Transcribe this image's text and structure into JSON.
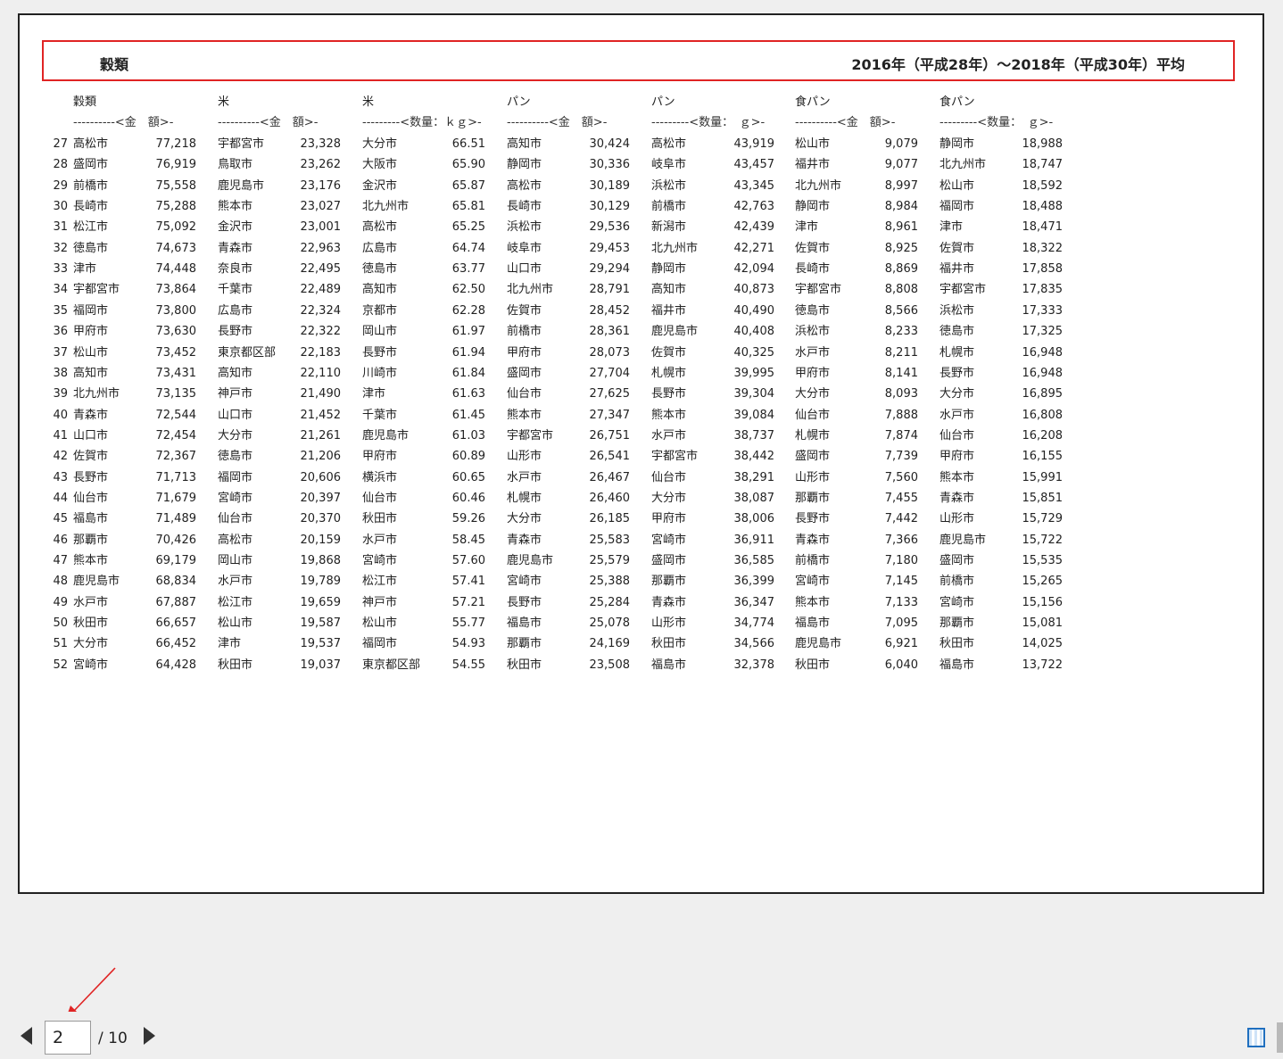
{
  "document": {
    "title_left": "穀類",
    "title_right": "2016年（平成28年）～2018年（平成30年）平均",
    "columns": [
      {
        "header": "穀類",
        "unit": "----------<金　額>-"
      },
      {
        "header": "米",
        "unit": "----------<金　額>-"
      },
      {
        "header": "米",
        "unit": "---------<数量：ｋｇ>-"
      },
      {
        "header": "パン",
        "unit": "----------<金　額>-"
      },
      {
        "header": "パン",
        "unit": "---------<数量：　ｇ>-"
      },
      {
        "header": "食パン",
        "unit": "----------<金　額>-"
      },
      {
        "header": "食パン",
        "unit": "---------<数量：　ｇ>-"
      }
    ],
    "rows": [
      {
        "rank": "27",
        "c": [
          [
            "高松市",
            "77,218"
          ],
          [
            "宇都宮市",
            "23,328"
          ],
          [
            "大分市",
            "66.51"
          ],
          [
            "高知市",
            "30,424"
          ],
          [
            "高松市",
            "43,919"
          ],
          [
            "松山市",
            "9,079"
          ],
          [
            "静岡市",
            "18,988"
          ]
        ]
      },
      {
        "rank": "28",
        "c": [
          [
            "盛岡市",
            "76,919"
          ],
          [
            "鳥取市",
            "23,262"
          ],
          [
            "大阪市",
            "65.90"
          ],
          [
            "静岡市",
            "30,336"
          ],
          [
            "岐阜市",
            "43,457"
          ],
          [
            "福井市",
            "9,077"
          ],
          [
            "北九州市",
            "18,747"
          ]
        ]
      },
      {
        "rank": "29",
        "c": [
          [
            "前橋市",
            "75,558"
          ],
          [
            "鹿児島市",
            "23,176"
          ],
          [
            "金沢市",
            "65.87"
          ],
          [
            "高松市",
            "30,189"
          ],
          [
            "浜松市",
            "43,345"
          ],
          [
            "北九州市",
            "8,997"
          ],
          [
            "松山市",
            "18,592"
          ]
        ]
      },
      {
        "rank": "30",
        "c": [
          [
            "長崎市",
            "75,288"
          ],
          [
            "熊本市",
            "23,027"
          ],
          [
            "北九州市",
            "65.81"
          ],
          [
            "長崎市",
            "30,129"
          ],
          [
            "前橋市",
            "42,763"
          ],
          [
            "静岡市",
            "8,984"
          ],
          [
            "福岡市",
            "18,488"
          ]
        ]
      },
      {
        "rank": "31",
        "c": [
          [
            "松江市",
            "75,092"
          ],
          [
            "金沢市",
            "23,001"
          ],
          [
            "高松市",
            "65.25"
          ],
          [
            "浜松市",
            "29,536"
          ],
          [
            "新潟市",
            "42,439"
          ],
          [
            "津市",
            "8,961"
          ],
          [
            "津市",
            "18,471"
          ]
        ]
      },
      {
        "rank": "32",
        "c": [
          [
            "徳島市",
            "74,673"
          ],
          [
            "青森市",
            "22,963"
          ],
          [
            "広島市",
            "64.74"
          ],
          [
            "岐阜市",
            "29,453"
          ],
          [
            "北九州市",
            "42,271"
          ],
          [
            "佐賀市",
            "8,925"
          ],
          [
            "佐賀市",
            "18,322"
          ]
        ]
      },
      {
        "rank": "33",
        "c": [
          [
            "津市",
            "74,448"
          ],
          [
            "奈良市",
            "22,495"
          ],
          [
            "徳島市",
            "63.77"
          ],
          [
            "山口市",
            "29,294"
          ],
          [
            "静岡市",
            "42,094"
          ],
          [
            "長崎市",
            "8,869"
          ],
          [
            "福井市",
            "17,858"
          ]
        ]
      },
      {
        "rank": "34",
        "c": [
          [
            "宇都宮市",
            "73,864"
          ],
          [
            "千葉市",
            "22,489"
          ],
          [
            "高知市",
            "62.50"
          ],
          [
            "北九州市",
            "28,791"
          ],
          [
            "高知市",
            "40,873"
          ],
          [
            "宇都宮市",
            "8,808"
          ],
          [
            "宇都宮市",
            "17,835"
          ]
        ]
      },
      {
        "rank": "35",
        "c": [
          [
            "福岡市",
            "73,800"
          ],
          [
            "広島市",
            "22,324"
          ],
          [
            "京都市",
            "62.28"
          ],
          [
            "佐賀市",
            "28,452"
          ],
          [
            "福井市",
            "40,490"
          ],
          [
            "徳島市",
            "8,566"
          ],
          [
            "浜松市",
            "17,333"
          ]
        ]
      },
      {
        "rank": "36",
        "c": [
          [
            "甲府市",
            "73,630"
          ],
          [
            "長野市",
            "22,322"
          ],
          [
            "岡山市",
            "61.97"
          ],
          [
            "前橋市",
            "28,361"
          ],
          [
            "鹿児島市",
            "40,408"
          ],
          [
            "浜松市",
            "8,233"
          ],
          [
            "徳島市",
            "17,325"
          ]
        ]
      },
      {
        "rank": "37",
        "c": [
          [
            "松山市",
            "73,452"
          ],
          [
            "東京都区部",
            "22,183"
          ],
          [
            "長野市",
            "61.94"
          ],
          [
            "甲府市",
            "28,073"
          ],
          [
            "佐賀市",
            "40,325"
          ],
          [
            "水戸市",
            "8,211"
          ],
          [
            "札幌市",
            "16,948"
          ]
        ]
      },
      {
        "rank": "38",
        "c": [
          [
            "高知市",
            "73,431"
          ],
          [
            "高知市",
            "22,110"
          ],
          [
            "川崎市",
            "61.84"
          ],
          [
            "盛岡市",
            "27,704"
          ],
          [
            "札幌市",
            "39,995"
          ],
          [
            "甲府市",
            "8,141"
          ],
          [
            "長野市",
            "16,948"
          ]
        ]
      },
      {
        "rank": "39",
        "c": [
          [
            "北九州市",
            "73,135"
          ],
          [
            "神戸市",
            "21,490"
          ],
          [
            "津市",
            "61.63"
          ],
          [
            "仙台市",
            "27,625"
          ],
          [
            "長野市",
            "39,304"
          ],
          [
            "大分市",
            "8,093"
          ],
          [
            "大分市",
            "16,895"
          ]
        ]
      },
      {
        "rank": "40",
        "c": [
          [
            "青森市",
            "72,544"
          ],
          [
            "山口市",
            "21,452"
          ],
          [
            "千葉市",
            "61.45"
          ],
          [
            "熊本市",
            "27,347"
          ],
          [
            "熊本市",
            "39,084"
          ],
          [
            "仙台市",
            "7,888"
          ],
          [
            "水戸市",
            "16,808"
          ]
        ]
      },
      {
        "rank": "41",
        "c": [
          [
            "山口市",
            "72,454"
          ],
          [
            "大分市",
            "21,261"
          ],
          [
            "鹿児島市",
            "61.03"
          ],
          [
            "宇都宮市",
            "26,751"
          ],
          [
            "水戸市",
            "38,737"
          ],
          [
            "札幌市",
            "7,874"
          ],
          [
            "仙台市",
            "16,208"
          ]
        ]
      },
      {
        "rank": "42",
        "c": [
          [
            "佐賀市",
            "72,367"
          ],
          [
            "徳島市",
            "21,206"
          ],
          [
            "甲府市",
            "60.89"
          ],
          [
            "山形市",
            "26,541"
          ],
          [
            "宇都宮市",
            "38,442"
          ],
          [
            "盛岡市",
            "7,739"
          ],
          [
            "甲府市",
            "16,155"
          ]
        ]
      },
      {
        "rank": "43",
        "c": [
          [
            "長野市",
            "71,713"
          ],
          [
            "福岡市",
            "20,606"
          ],
          [
            "横浜市",
            "60.65"
          ],
          [
            "水戸市",
            "26,467"
          ],
          [
            "仙台市",
            "38,291"
          ],
          [
            "山形市",
            "7,560"
          ],
          [
            "熊本市",
            "15,991"
          ]
        ]
      },
      {
        "rank": "44",
        "c": [
          [
            "仙台市",
            "71,679"
          ],
          [
            "宮崎市",
            "20,397"
          ],
          [
            "仙台市",
            "60.46"
          ],
          [
            "札幌市",
            "26,460"
          ],
          [
            "大分市",
            "38,087"
          ],
          [
            "那覇市",
            "7,455"
          ],
          [
            "青森市",
            "15,851"
          ]
        ]
      },
      {
        "rank": "45",
        "c": [
          [
            "福島市",
            "71,489"
          ],
          [
            "仙台市",
            "20,370"
          ],
          [
            "秋田市",
            "59.26"
          ],
          [
            "大分市",
            "26,185"
          ],
          [
            "甲府市",
            "38,006"
          ],
          [
            "長野市",
            "7,442"
          ],
          [
            "山形市",
            "15,729"
          ]
        ]
      },
      {
        "rank": "46",
        "c": [
          [
            "那覇市",
            "70,426"
          ],
          [
            "高松市",
            "20,159"
          ],
          [
            "水戸市",
            "58.45"
          ],
          [
            "青森市",
            "25,583"
          ],
          [
            "宮崎市",
            "36,911"
          ],
          [
            "青森市",
            "7,366"
          ],
          [
            "鹿児島市",
            "15,722"
          ]
        ]
      },
      {
        "rank": "47",
        "c": [
          [
            "熊本市",
            "69,179"
          ],
          [
            "岡山市",
            "19,868"
          ],
          [
            "宮崎市",
            "57.60"
          ],
          [
            "鹿児島市",
            "25,579"
          ],
          [
            "盛岡市",
            "36,585"
          ],
          [
            "前橋市",
            "7,180"
          ],
          [
            "盛岡市",
            "15,535"
          ]
        ]
      },
      {
        "rank": "48",
        "c": [
          [
            "鹿児島市",
            "68,834"
          ],
          [
            "水戸市",
            "19,789"
          ],
          [
            "松江市",
            "57.41"
          ],
          [
            "宮崎市",
            "25,388"
          ],
          [
            "那覇市",
            "36,399"
          ],
          [
            "宮崎市",
            "7,145"
          ],
          [
            "前橋市",
            "15,265"
          ]
        ]
      },
      {
        "rank": "49",
        "c": [
          [
            "水戸市",
            "67,887"
          ],
          [
            "松江市",
            "19,659"
          ],
          [
            "神戸市",
            "57.21"
          ],
          [
            "長野市",
            "25,284"
          ],
          [
            "青森市",
            "36,347"
          ],
          [
            "熊本市",
            "7,133"
          ],
          [
            "宮崎市",
            "15,156"
          ]
        ]
      },
      {
        "rank": "50",
        "c": [
          [
            "秋田市",
            "66,657"
          ],
          [
            "松山市",
            "19,587"
          ],
          [
            "松山市",
            "55.77"
          ],
          [
            "福島市",
            "25,078"
          ],
          [
            "山形市",
            "34,774"
          ],
          [
            "福島市",
            "7,095"
          ],
          [
            "那覇市",
            "15,081"
          ]
        ]
      },
      {
        "rank": "51",
        "c": [
          [
            "大分市",
            "66,452"
          ],
          [
            "津市",
            "19,537"
          ],
          [
            "福岡市",
            "54.93"
          ],
          [
            "那覇市",
            "24,169"
          ],
          [
            "秋田市",
            "34,566"
          ],
          [
            "鹿児島市",
            "6,921"
          ],
          [
            "秋田市",
            "14,025"
          ]
        ]
      },
      {
        "rank": "52",
        "c": [
          [
            "宮崎市",
            "64,428"
          ],
          [
            "秋田市",
            "19,037"
          ],
          [
            "東京都区部",
            "54.55"
          ],
          [
            "秋田市",
            "23,508"
          ],
          [
            "福島市",
            "32,378"
          ],
          [
            "秋田市",
            "6,040"
          ],
          [
            "福島市",
            "13,722"
          ]
        ]
      }
    ]
  },
  "pagination": {
    "current_page": "2",
    "total_label": "/ 10"
  },
  "colors": {
    "highlight_border": "#e02424",
    "annotation_arrow": "#e02424",
    "view_icon": "#1f6fbf"
  }
}
